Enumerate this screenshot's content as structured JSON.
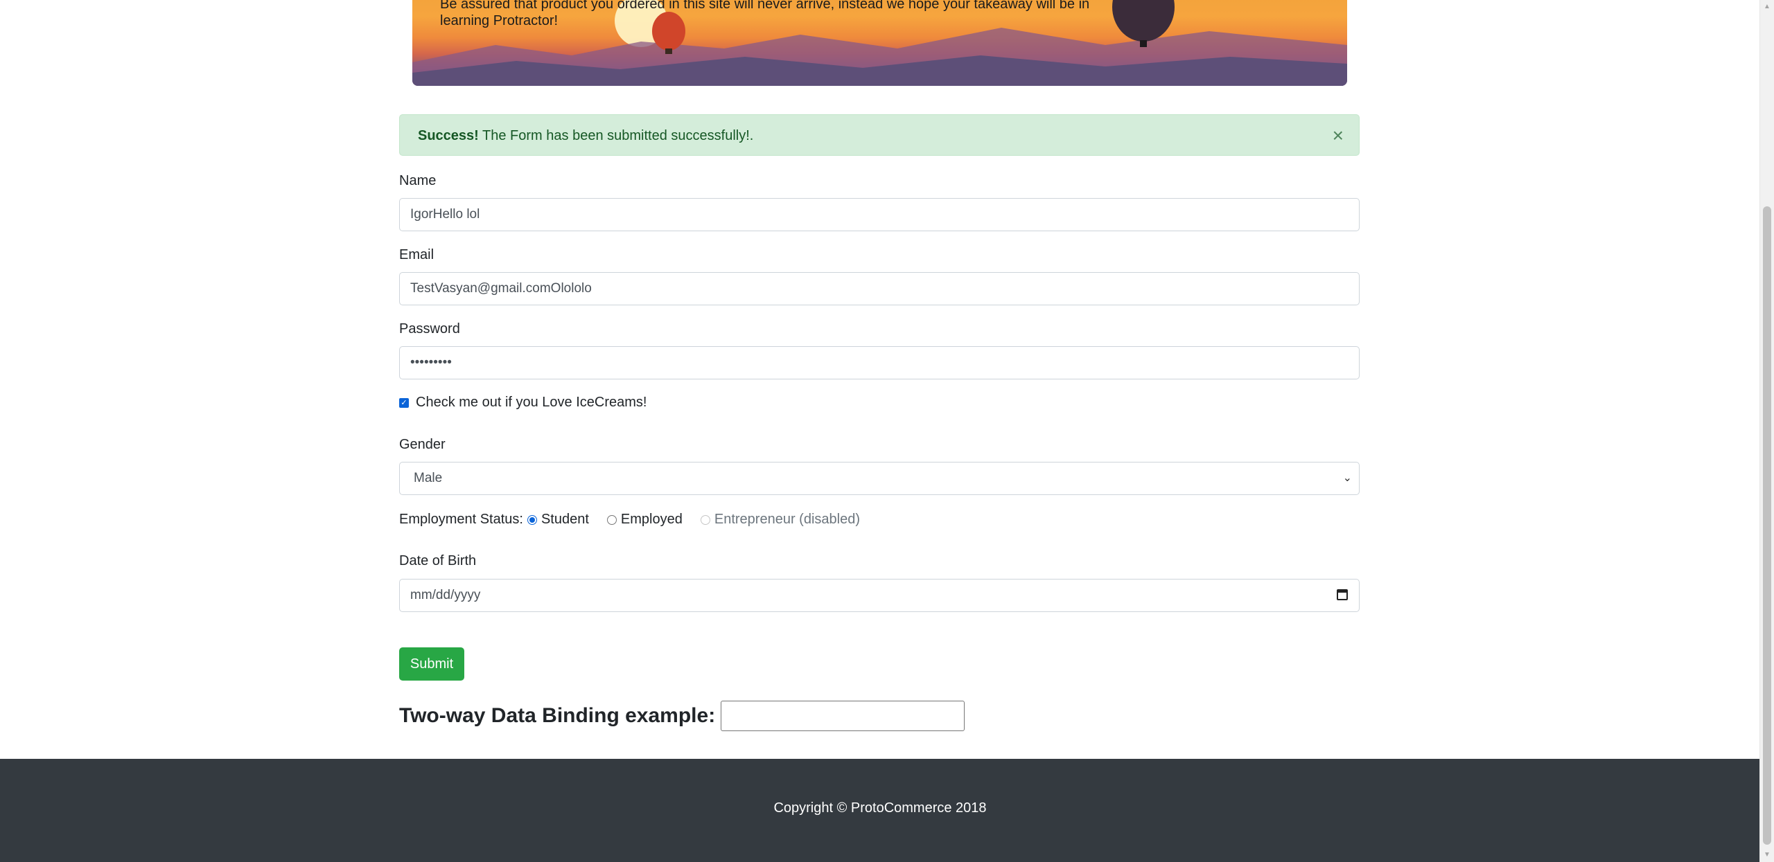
{
  "hero": {
    "text": "Be assured that product you ordered in this site will never arrive, instead we hope your takeaway will be in learning Protractor!"
  },
  "alert": {
    "strong": "Success!",
    "message": " The Form has been submitted successfully!.",
    "close": "×"
  },
  "form": {
    "name_label": "Name",
    "name_value": "IgorHello lol",
    "email_label": "Email",
    "email_value": "TestVasyan@gmail.comOlololo",
    "password_label": "Password",
    "password_value": "•••••••••",
    "checkbox_label": "Check me out if you Love IceCreams!",
    "checkbox_checked": true,
    "gender_label": "Gender",
    "gender_selected": "Male",
    "employment_label": "Employment Status:",
    "employment_options": [
      "Student",
      "Employed",
      "Entrepreneur (disabled)"
    ],
    "employment_selected": "Student",
    "dob_label": "Date of Birth",
    "dob_placeholder": "mm/dd/yyyy",
    "submit_label": "Submit"
  },
  "binding": {
    "label": "Two-way Data Binding example:",
    "value": ""
  },
  "footer": {
    "copyright": "Copyright © ProtoCommerce 2018"
  },
  "colors": {
    "success_bg": "#d4edda",
    "success_text": "#155724",
    "submit_bg": "#28a745",
    "footer_bg": "#343a40",
    "checkbox_accent": "#0b64d8"
  },
  "icons": {
    "close": "close-icon",
    "select_arrow": "chevron-down-icon",
    "calendar": "calendar-icon"
  }
}
